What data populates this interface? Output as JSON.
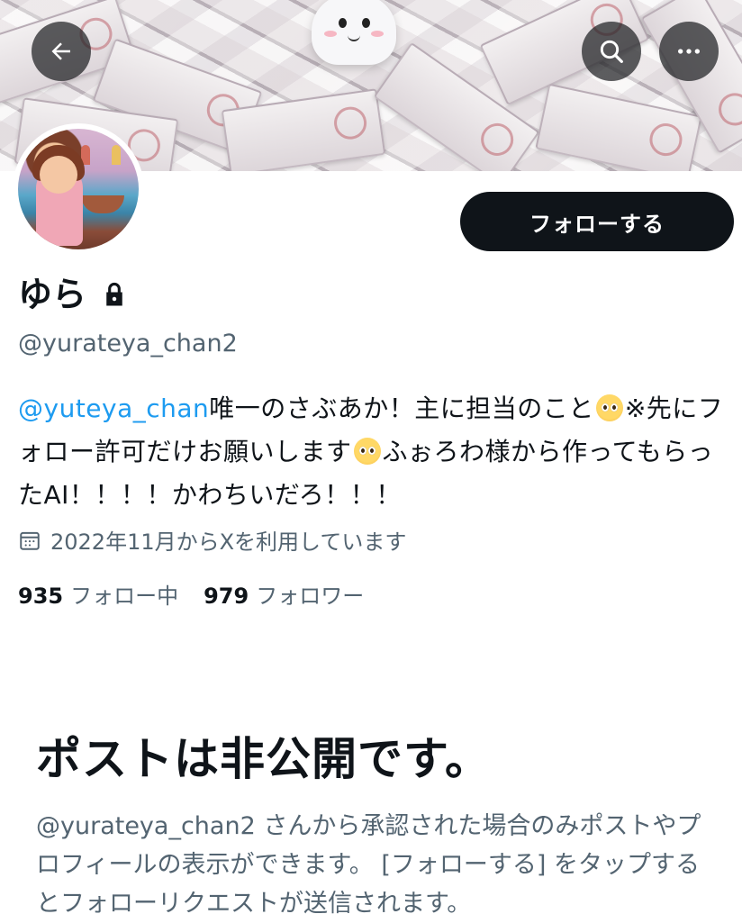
{
  "header": {
    "back_icon": "arrow-left-icon",
    "search_icon": "search-icon",
    "more_icon": "more-horizontal-icon"
  },
  "profile": {
    "display_name": "ゆら",
    "handle": "@yurateya_chan2",
    "follow_label": "フォローする",
    "bio": {
      "mention": "@yuteya_chan",
      "text_1": "唯一のさぶあか！主に担当のこと",
      "text_2": "※先にフォロー許可だけお願いします",
      "text_3": "ふぉろわ様から作ってもらったAI！！！！かわちいだろ！！！"
    },
    "joined": "2022年11月からXを利用しています",
    "following_count": "935",
    "following_label": "フォロー中",
    "followers_count": "979",
    "followers_label": "フォロワー"
  },
  "private_notice": {
    "title": "ポストは非公開です。",
    "description": "@yurateya_chan2 さんから承認された場合のみポストやプロフィールの表示ができます。 [フォローする] をタップするとフォローリクエストが送信されます。"
  },
  "colors": {
    "accent": "#1d9bf0",
    "text": "#0f1419",
    "secondary": "#536471",
    "button": "#0f1419"
  }
}
